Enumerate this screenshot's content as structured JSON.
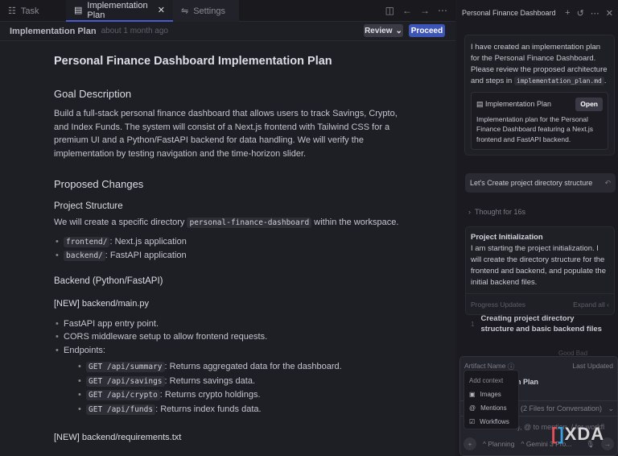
{
  "tabs": [
    {
      "label": "Task",
      "icon": "list-icon"
    },
    {
      "label": "Implementation Plan",
      "icon": "file-icon"
    },
    {
      "label": "Settings",
      "icon": "sliders-icon"
    }
  ],
  "header": {
    "title": "Implementation Plan",
    "subtitle": "about 1 month ago",
    "review_label": "Review",
    "proceed_label": "Proceed"
  },
  "doc": {
    "title": "Personal Finance Dashboard Implementation Plan",
    "goal_heading": "Goal Description",
    "goal_text": "Build a full-stack personal finance dashboard that allows users to track Savings, Crypto, and Index Funds. The system will consist of a Next.js frontend with Tailwind CSS for a premium UI and a Python/FastAPI backend for data handling. We will verify the implementation by testing navigation and the time-horizon slider.",
    "changes_heading": "Proposed Changes",
    "structure_heading": "Project Structure",
    "structure_pre": "We will create a specific directory",
    "structure_code": "personal-finance-dashboard",
    "structure_post": "within the workspace.",
    "dirs": [
      {
        "code": "frontend/",
        "text": ": Next.js application"
      },
      {
        "code": "backend/",
        "text": ": FastAPI application"
      }
    ],
    "backend_heading": "Backend (Python/FastAPI)",
    "main_heading": "[NEW] backend/main.py",
    "main_items": [
      "FastAPI app entry point.",
      "CORS middleware setup to allow frontend requests.",
      "Endpoints:"
    ],
    "endpoints": [
      {
        "code": "GET /api/summary",
        "text": ": Returns aggregated data for the dashboard."
      },
      {
        "code": "GET /api/savings",
        "text": ": Returns savings data."
      },
      {
        "code": "GET /api/crypto",
        "text": ": Returns crypto holdings."
      },
      {
        "code": "GET /api/funds",
        "text": ": Returns index funds data."
      }
    ],
    "req_heading": "[NEW] backend/requirements.txt"
  },
  "panel": {
    "title": "Personal Finance Dashboard",
    "msg_pre": "I have created an implementation plan for the Personal Finance Dashboard. Please review the proposed architecture and steps in",
    "msg_code": "implementation_plan.md",
    "artifact_title": "Implementation Plan",
    "open_label": "Open",
    "artifact_desc": "Implementation plan for the Personal Finance Dashboard featuring a Next.js frontend and FastAPI backend.",
    "user_msg": "Let's Create project directory structure",
    "thought": "Thought for 16s",
    "task_title": "Project Initialization",
    "task_text": "I am starting the project initialization. I will create the directory structure for the frontend and backend, and populate the initial backend files.",
    "progress_label": "Progress Updates",
    "expand_label": "Expand all",
    "step_num": "1",
    "step_text": "Creating project directory structure and basic backend files",
    "feedback": "Good   Bad",
    "artifact_name_label": "Artifact Name",
    "last_updated_label": "Last Updated",
    "artifact_row": "n Plan",
    "files_label": "2 Files for Conversation)",
    "input_hint": "L), @ to mention, / for workfl",
    "mode_label": "Planning",
    "model_label": "Gemini 3 Pro..."
  },
  "context_menu": {
    "title": "Add context",
    "items": [
      "Images",
      "Mentions",
      "Workflows"
    ]
  },
  "watermark": "XDA"
}
